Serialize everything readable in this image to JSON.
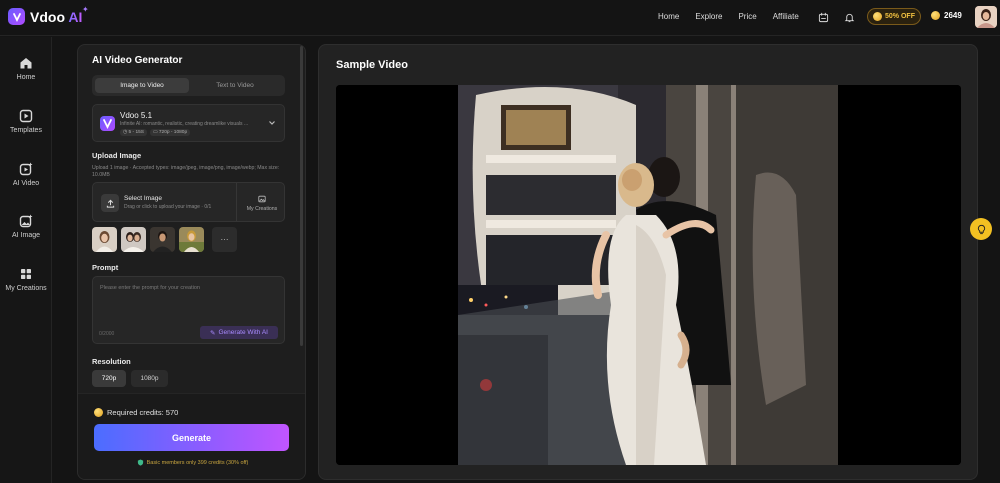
{
  "brand": {
    "name": "Vdoo ",
    "ai": "AI"
  },
  "nav": [
    "Home",
    "Explore",
    "Price",
    "Affiliate"
  ],
  "promo": "50% OFF",
  "credits_balance": "2649",
  "sidebar": [
    {
      "label": "Home",
      "icon": "home-icon"
    },
    {
      "label": "Templates",
      "icon": "templates-icon"
    },
    {
      "label": "AI Video",
      "icon": "ai-video-icon"
    },
    {
      "label": "AI Image",
      "icon": "ai-image-icon"
    },
    {
      "label": "My Creations",
      "icon": "grid-icon"
    }
  ],
  "panel": {
    "title": "AI Video Generator",
    "tabs": [
      "Image to Video",
      "Text to Video"
    ],
    "model": {
      "name": "Vdoo 5.1",
      "desc": "Infinite AI: romantic, realistic, creating dreamlike visuals ...",
      "tags": [
        "5 - 15S",
        "720p - 1080p"
      ]
    },
    "upload": {
      "label": "Upload Image",
      "hint": "Upload 1 image · Accepted types: image/jpeg, image/png, image/webp; Max size: 10.0MB",
      "title": "Select Image",
      "sub": "Drag or click to upload your image · 0/1",
      "my_creations": "My Creations",
      "more": "···"
    },
    "prompt": {
      "label": "Prompt",
      "placeholder": "Please enter the prompt for your creation",
      "count": "0/2000",
      "generate_with_ai": "Generate With AI"
    },
    "resolution": {
      "label": "Resolution",
      "options": [
        "720p",
        "1080p"
      ],
      "selected": "720p"
    },
    "required_credits": "Required credits: 570",
    "generate": "Generate",
    "basic_note": "Basic members only 399 credits (30% off)"
  },
  "sample": {
    "title": "Sample Video"
  }
}
